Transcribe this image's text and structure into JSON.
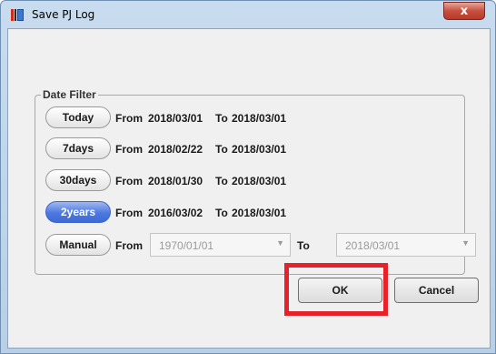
{
  "window": {
    "title": "Save PJ Log",
    "close_label": "x",
    "icon": "app-icon",
    "icon_colors": [
      "#d42a1c",
      "#2b2b2b",
      "#3a78d4"
    ]
  },
  "date_filter": {
    "legend": "Date Filter",
    "rows": [
      {
        "button": "Today",
        "from_label": "From",
        "from": "2018/03/01",
        "to_label": "To",
        "to": "2018/03/01",
        "active": false
      },
      {
        "button": "7days",
        "from_label": "From",
        "from": "2018/02/22",
        "to_label": "To",
        "to": "2018/03/01",
        "active": false
      },
      {
        "button": "30days",
        "from_label": "From",
        "from": "2018/01/30",
        "to_label": "To",
        "to": "2018/03/01",
        "active": false
      },
      {
        "button": "2years",
        "from_label": "From",
        "from": "2016/03/02",
        "to_label": "To",
        "to": "2018/03/01",
        "active": true
      }
    ],
    "manual": {
      "button": "Manual",
      "from_label": "From",
      "from_value": "1970/01/01",
      "to_label": "To",
      "to_value": "2018/03/01",
      "dropdown_icon": "chevron-down-icon"
    }
  },
  "actions": {
    "ok_label": "OK",
    "cancel_label": "Cancel"
  },
  "colors": {
    "active_button": "#4c78df",
    "highlight": "#e8202a"
  }
}
